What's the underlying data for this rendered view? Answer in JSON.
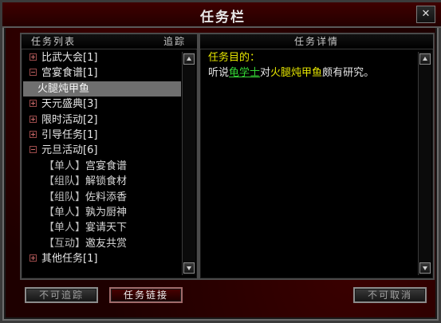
{
  "window": {
    "title": "任务栏"
  },
  "left_panel": {
    "header_left": "任务列表",
    "header_right": "追踪"
  },
  "right_panel": {
    "header": "任务详情",
    "detail": {
      "title": "任务目的：",
      "line_pre": "听说",
      "npc": "龟学士",
      "mid": "对",
      "item": "火腿炖甲鱼",
      "post": "颇有研究。"
    }
  },
  "quest_list": [
    {
      "type": "cat",
      "toggle": "plus",
      "label": "比武大会[1]"
    },
    {
      "type": "cat",
      "toggle": "minus",
      "label": "宫宴食谱[1]"
    },
    {
      "type": "child",
      "label": "火腿炖甲鱼",
      "selected": true
    },
    {
      "type": "cat",
      "toggle": "plus",
      "label": "天元盛典[3]"
    },
    {
      "type": "cat",
      "toggle": "plus",
      "label": "限时活动[2]"
    },
    {
      "type": "cat",
      "toggle": "plus",
      "label": "引导任务[1]"
    },
    {
      "type": "cat",
      "toggle": "minus",
      "label": "元旦活动[6]"
    },
    {
      "type": "sub",
      "tag": "【单人】",
      "label": "宫宴食谱"
    },
    {
      "type": "sub",
      "tag": "【组队】",
      "label": "解锁食材"
    },
    {
      "type": "sub",
      "tag": "【组队】",
      "label": "佐料添香"
    },
    {
      "type": "sub",
      "tag": "【单人】",
      "label": "孰为厨神"
    },
    {
      "type": "sub",
      "tag": "【单人】",
      "label": "宴请天下"
    },
    {
      "type": "sub",
      "tag": "【互动】",
      "label": "邀友共赏"
    },
    {
      "type": "cat",
      "toggle": "plus",
      "label": "其他任务[1]"
    }
  ],
  "buttons": {
    "untrack": "不可追踪",
    "link": "任务链接",
    "cancel": "不可取消"
  },
  "colors": {
    "accent_yellow": "#e6e600",
    "link_green": "#35d535",
    "frame_red": "#1e0000"
  },
  "icons": [
    "close-icon",
    "scroll-up-arrow-icon",
    "scroll-down-arrow-icon",
    "expand-plus-icon",
    "collapse-minus-icon"
  ]
}
